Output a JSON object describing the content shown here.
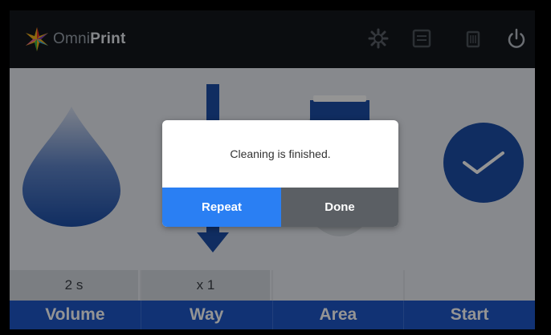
{
  "app": {
    "brand_light": "Omni",
    "brand_bold": "Print"
  },
  "topbar": {
    "icons": [
      "gear-icon",
      "printer-icon",
      "trash-icon",
      "power-icon"
    ]
  },
  "steps": {
    "values": [
      "2 s",
      "x 1",
      "",
      ""
    ],
    "tabs": [
      "Volume",
      "Way",
      "Area",
      "Start"
    ]
  },
  "dialog": {
    "message": "Cleaning is finished.",
    "repeat_label": "Repeat",
    "done_label": "Done"
  },
  "colors": {
    "accent": "#1e56c8",
    "repeat": "#2a7ff3",
    "done": "#5b5f64",
    "topbar": "#14171c"
  }
}
